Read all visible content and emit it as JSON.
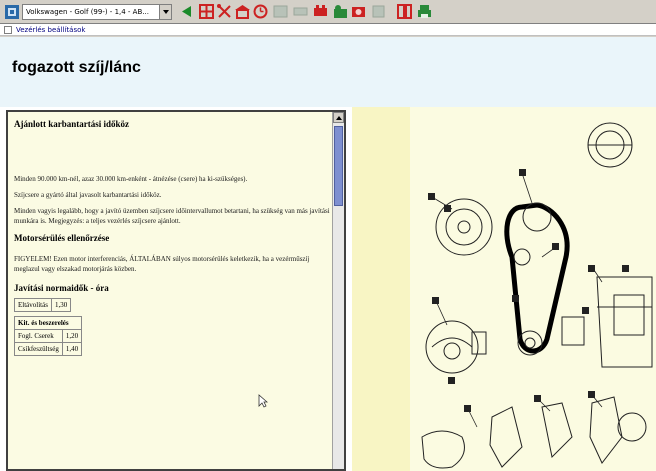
{
  "toolbar": {
    "vehicle_select": "Volkswagen - Golf (99-) - 1,4 - AB...",
    "buttons": [
      {
        "name": "back-icon",
        "color": "#1a8a2a"
      },
      {
        "name": "grid-icon",
        "color": "#cc2222"
      },
      {
        "name": "tools-icon",
        "color": "#cc2222"
      },
      {
        "name": "garage-icon",
        "color": "#cc2222"
      },
      {
        "name": "clock-icon",
        "color": "#cc2222"
      },
      {
        "name": "disabled-icon-1",
        "color": "#9aa69a"
      },
      {
        "name": "disabled-icon-2",
        "color": "#9aa69a"
      },
      {
        "name": "wrench-icon",
        "color": "#cc2222"
      },
      {
        "name": "tree-icon",
        "color": "#2a8a3a"
      },
      {
        "name": "camera-icon",
        "color": "#cc2222"
      },
      {
        "name": "disabled-icon-3",
        "color": "#9aa69a"
      },
      {
        "name": "pages-icon",
        "color": "#cc2222"
      },
      {
        "name": "print-icon",
        "color": "#2a8a3a"
      }
    ]
  },
  "tab": {
    "label": "Vezérlés beállítások"
  },
  "page": {
    "title": "fogazott szíj/lánc"
  },
  "text_panel": {
    "section1_title": "Ajánlott karbantartási időköz",
    "paragraphs": [
      "Minden 90.000 km-nél, azaz 30.000 km-enként - átnézése (csere) ha ki-szükséges).",
      "Szíjcsere a gyártó által javasolt karbantartási időköz.",
      "Minden vagyis legalább, hogy a javító üzemben szíjcsere időintervallumot betartani, ha szükség van más javítási munkára is. Megjegyzés: a teljes vezérlés szíjcsere ajánlott.",
      ""
    ],
    "section2_title": "Motorsérülés ellenőrzése",
    "paragraph2": "FIGYELEM! Ezen motor interferenciás, ÁLTALÁBAN súlyos motorsérülés keletkezik, ha a vezérműszíj meglazul vagy elszakad motorjárás közben.",
    "section3_title": "Javítási normaidők - óra",
    "small_table": [
      [
        "Eltávolítás",
        "1,30"
      ]
    ],
    "spec_table_header": "Kit. és beszerelés",
    "spec_table_rows": [
      [
        "Fogl. Cserek",
        "1,20"
      ],
      [
        "Csíkfeszültség",
        "1,40"
      ]
    ]
  }
}
